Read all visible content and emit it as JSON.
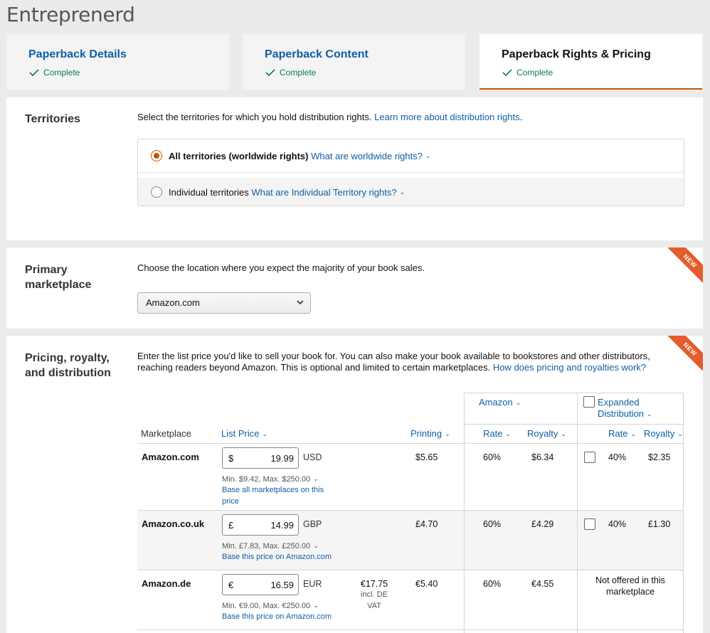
{
  "app_title": "Entreprenerd",
  "tabs": [
    {
      "label": "Paperback Details",
      "status": "Complete"
    },
    {
      "label": "Paperback Content",
      "status": "Complete"
    },
    {
      "label": "Paperback Rights & Pricing",
      "status": "Complete"
    }
  ],
  "territories": {
    "title": "Territories",
    "desc": "Select the territories for which you hold distribution rights.",
    "desc_link": "Learn more about distribution rights",
    "desc_end": ".",
    "opt_all": "All territories (worldwide rights)",
    "opt_all_link": "What are worldwide rights?",
    "opt_individual": "Individual territories",
    "opt_individual_link": "What are Individual Territory rights?"
  },
  "primary": {
    "title_line1": "Primary",
    "title_line2": "marketplace",
    "desc": "Choose the location where you expect the majority of your book sales.",
    "selected": "Amazon.com",
    "badge": "NEW"
  },
  "pricing": {
    "title_line1": "Pricing, royalty,",
    "title_line2": "and distribution",
    "badge": "NEW",
    "desc_line1": "Enter the list price you'd like to sell your book for. You can also make your book available to bookstores and other distributors,",
    "desc_line2": "reaching readers beyond Amazon. This is optional and limited to certain marketplaces.",
    "desc_link": "How does pricing and royalties work?",
    "headers": {
      "amazon": "Amazon",
      "expanded_1": "Expanded",
      "expanded_2": "Distribution",
      "marketplace": "Marketplace",
      "list_price": "List Price",
      "printing": "Printing",
      "rate": "Rate",
      "royalty": "Royalty",
      "ed_rate": "Rate",
      "ed_royalty": "Royalty"
    },
    "rows": [
      {
        "marketplace": "Amazon.com",
        "currency_symbol": "$",
        "price": "19.99",
        "currency": "USD",
        "minmax": "Min. $9.42, Max. $250.00",
        "base_1": "Base all marketplaces on this",
        "base_2": "price",
        "printing": "$5.65",
        "rate": "60%",
        "royalty": "$6.34",
        "ed_rate": "40%",
        "ed_royalty": "$2.35"
      },
      {
        "marketplace": "Amazon.co.uk",
        "currency_symbol": "£",
        "price": "14.99",
        "currency": "GBP",
        "minmax": "Min. £7.83, Max. £250.00",
        "base_1": "Base this price on Amazon.com",
        "printing": "£4.70",
        "rate": "60%",
        "royalty": "£4.29",
        "ed_rate": "40%",
        "ed_royalty": "£1.30"
      },
      {
        "marketplace": "Amazon.de",
        "currency_symbol": "€",
        "price": "16.59",
        "currency": "EUR",
        "incl_price": "€17.75",
        "incl_1": "incl. DE",
        "incl_2": "VAT",
        "minmax": "Min. €9.00, Max. €250.00",
        "base_1": "Base this price on Amazon.com",
        "printing": "€5.40",
        "rate": "60%",
        "royalty": "€4.55",
        "ed_note_1": "Not offered in this",
        "ed_note_2": "marketplace"
      }
    ]
  }
}
